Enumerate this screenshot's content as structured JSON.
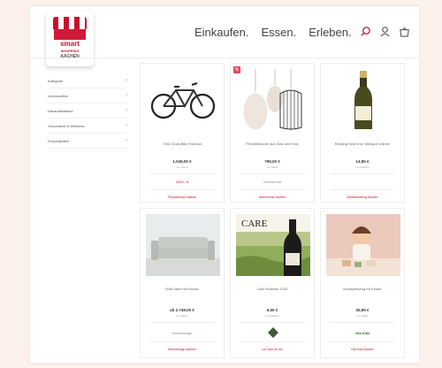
{
  "logo": {
    "line1": "smart",
    "line2": "SHOPPING",
    "line3": "AACHEN"
  },
  "nav": [
    "Einkaufen.",
    "Essen.",
    "Erleben."
  ],
  "icons": [
    "search-icon",
    "user-icon",
    "bag-icon"
  ],
  "colors": {
    "accent": "#c8102e",
    "background": "#fdf1ec"
  },
  "sidebar": {
    "items": [
      {
        "label": "Kategorie"
      },
      {
        "label": "Lebensmittel"
      },
      {
        "label": "Haushaltsartikel"
      },
      {
        "label": "Gesundheit & Wellness"
      },
      {
        "label": "Freizeitartikel"
      }
    ]
  },
  "products": [
    {
      "title": "Trek Cross Bike Fahrrad",
      "price": "1.049,00 €",
      "unit": "pro Stück",
      "extra": "1499,- €",
      "vendor_logo": "",
      "vendor": "Fahrradshop Aachen"
    },
    {
      "title": "Pendelleuchte aus Glas und Holz",
      "price": "799,00 €",
      "unit": "pro Stück",
      "extra": "",
      "vendor_logo": "Wohnkunst",
      "vendor": "Wohnkunst Aachen"
    },
    {
      "title": "Riesling Sekt brut, Weingut Vollmer",
      "price": "14,95 €",
      "unit": "pro Flasche",
      "extra": "",
      "vendor_logo": "",
      "vendor": "Weinhandlung Aachen"
    },
    {
      "title": "Sofa Samt mit Kissen",
      "price": "ab 2.749,00 €",
      "unit": "pro Stück",
      "extra": "",
      "vendor_logo": "Wohndesign",
      "vendor": "Wohndesign Aachen"
    },
    {
      "title": "Care Rotwein 2020",
      "price": "6,50 €",
      "unit": "pro Flasche",
      "extra": "",
      "vendor_logo": "",
      "vendor": "La Cave du Vin"
    },
    {
      "title": "Holzspielzeug für Kinder",
      "price": "25,95 €",
      "unit": "pro Stück",
      "extra": "",
      "vendor_logo": "Vita Kids",
      "vendor": "Vita Kids Aachen"
    }
  ]
}
